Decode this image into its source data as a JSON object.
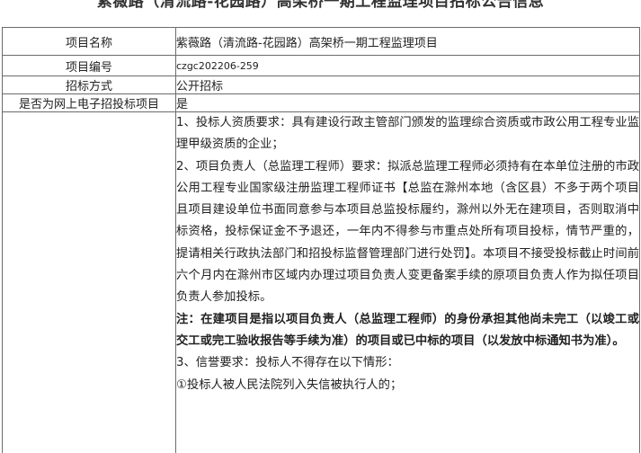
{
  "title": "紫薇路（清流路-花园路）高架桥一期工程监理项目招标公告信息",
  "rows": [
    {
      "label": "项目名称",
      "value": "紫薇路（清流路-花园路）高架桥一期工程监理项目"
    },
    {
      "label": "项目编号",
      "value": "czgc202206-259"
    },
    {
      "label": "招标方式",
      "value": "公开招标"
    },
    {
      "label": "是否为网上电子招投标项目",
      "value": "是"
    }
  ],
  "requirements": {
    "p1": "1、投标人资质要求：具有建设行政主管部门颁发的监理综合资质或市政公用工程专业监理甲级资质的企业；",
    "p2": "2、项目负责人（总监理工程师）要求：拟派总监理工程师必须持有在本单位注册的市政公用工程专业国家级注册监理工程师证书【总监在滁州本地（含区县）不多于两个项目且项目建设单位书面同意参与本项目总监投标履约，滁州以外无在建项目，否则取消中标资格，投标保证金不予退还，一年内不得参与市重点处所有项目投标，情节严重的，提请相关行政执法部门和招投标监督管理部门进行处罚】。本项目不接受投标截止时间前六个月内在滁州市区域内办理过项目负责人变更备案手续的原项目负责人作为拟任项目负责人参加投标。",
    "note": "注：在建项目是指以项目负责人（总监理工程师）的身份承担其他尚未完工（以竣工或交工或完工验收报告等手续为准）的项目或已中标的项目（以发放中标通知书为准）。",
    "p3": "3、信誉要求：投标人不得存在以下情形：",
    "p4": "①投标人被人民法院列入失信被执行人的；"
  }
}
